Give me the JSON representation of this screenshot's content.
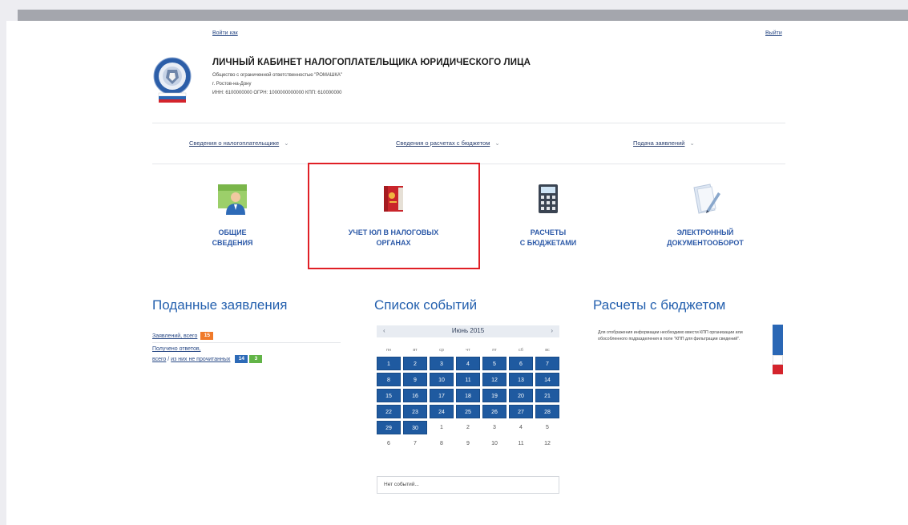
{
  "header": {
    "enter_as_link": "Войти как",
    "exit_link": "Выйти",
    "title": "ЛИЧНЫЙ КАБИНЕТ НАЛОГОПЛАТЕЛЬЩИКА ЮРИДИЧЕСКОГО ЛИЦА",
    "org_name": "Общество с ограниченной ответственностью \"РОМАШКА\"",
    "city": "г. Ростов-на-Дону",
    "ids": "ИНН: 6100000000 ОГРН: 1000000000000 КПП: 610000000"
  },
  "nav": {
    "items": [
      {
        "label": "Сведения о налогоплательщике"
      },
      {
        "label": "Сведения о расчетах с бюджетом"
      },
      {
        "label": "Подача заявлений"
      }
    ]
  },
  "tiles": [
    {
      "label_line1": "ОБЩИЕ",
      "label_line2": "СВЕДЕНИЯ",
      "icon": "person-icon"
    },
    {
      "label_line1": "УЧЕТ ЮЛ В НАЛОГОВЫХ",
      "label_line2": "ОРГАНАХ",
      "icon": "red-folder-icon"
    },
    {
      "label_line1": "РАСЧЕТЫ",
      "label_line2": "С БЮДЖЕТАМИ",
      "icon": "calculator-icon"
    },
    {
      "label_line1": "ЭЛЕКТРОННЫЙ",
      "label_line2": "ДОКУМЕНТООБОРОТ",
      "icon": "document-pen-icon"
    }
  ],
  "applications": {
    "title": "Поданные заявления",
    "all_label": "Заявлений, всего",
    "all_count": "15",
    "received_line1": "Получено ответов,",
    "received_all_label": "всего",
    "separator": " / ",
    "unread_label": "из них не прочитанных",
    "received_count": "14",
    "unread_count": "3"
  },
  "events": {
    "title": "Список событий",
    "month": "Июнь 2015",
    "prev_arrow": "‹",
    "next_arrow": "›",
    "weekdays": [
      "пн",
      "вт",
      "ср",
      "чт",
      "пт",
      "сб",
      "вс"
    ],
    "weeks": [
      [
        "1",
        "2",
        "3",
        "4",
        "5",
        "6",
        "7"
      ],
      [
        "8",
        "9",
        "10",
        "11",
        "12",
        "13",
        "14"
      ],
      [
        "15",
        "16",
        "17",
        "18",
        "19",
        "20",
        "21"
      ],
      [
        "22",
        "23",
        "24",
        "25",
        "26",
        "27",
        "28"
      ],
      [
        "29",
        "30",
        "1",
        "2",
        "3",
        "4",
        "5"
      ],
      [
        "6",
        "7",
        "8",
        "9",
        "10",
        "11",
        "12"
      ]
    ],
    "in_month_count": 30,
    "no_events": "Нет событий..."
  },
  "budget": {
    "title": "Расчеты с бюджетом",
    "info_text": "Для отображения информации необходимо ввести КПП организации или обособленного подразделения в поле \"КПП для фильтрации сведений\"."
  },
  "colors": {
    "accent_blue": "#2460ae",
    "highlight_red": "#e01f26",
    "calendar_blue": "#1f5aa0"
  }
}
